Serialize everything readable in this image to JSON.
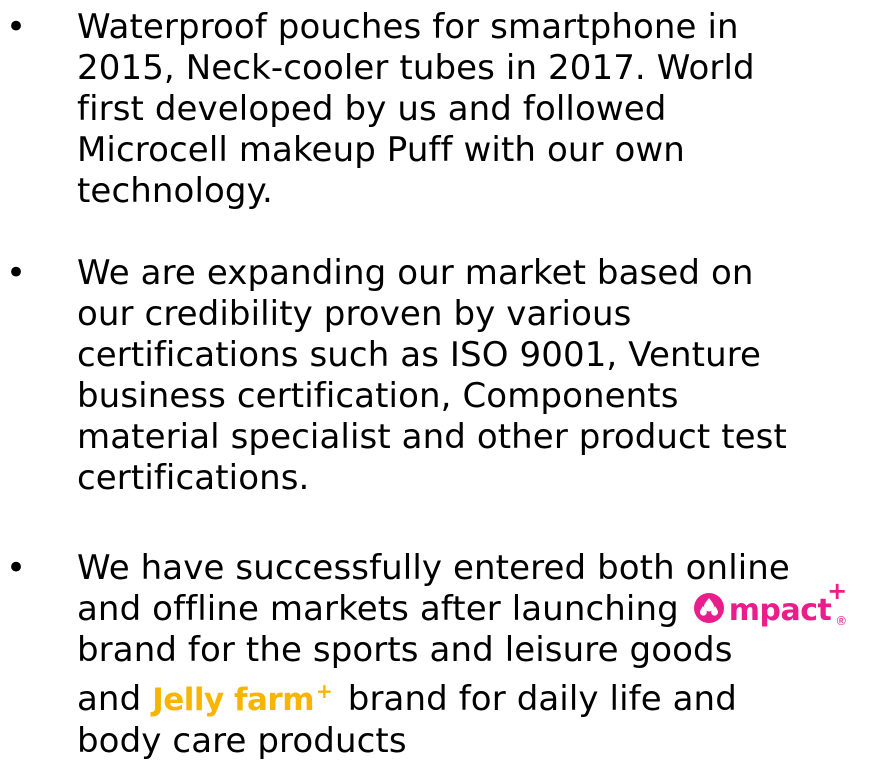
{
  "bullet_symbol": "•",
  "bullets": [
    {
      "lines": [
        "Waterproof pouches for smartphone in",
        "2015, Neck-cooler tubes in 2017. World",
        "first developed by us and followed",
        "Microcell makeup Puff with our own",
        "technology."
      ]
    },
    {
      "lines": [
        "We are expanding our market based on",
        "our credibility proven by various",
        "certifications such as ISO 9001, Venture",
        "business certification, Components",
        "material specialist and other product test",
        "certifications."
      ]
    },
    {
      "line1": "We have successfully entered both online",
      "line2_before": "and offline markets after launching",
      "line3": "brand for the sports and leisure goods",
      "line4_before": "and",
      "line4_after": "brand for daily life and",
      "line5": "body care products"
    }
  ],
  "logos": {
    "mpact": {
      "text": "mpact",
      "plus": "+",
      "registered": "®",
      "color": "#e91e8c",
      "icon": "mpact-droplets-icon"
    },
    "jellyfarm": {
      "text": "Jelly farm",
      "plus": "+",
      "color": "#f7b500"
    }
  }
}
